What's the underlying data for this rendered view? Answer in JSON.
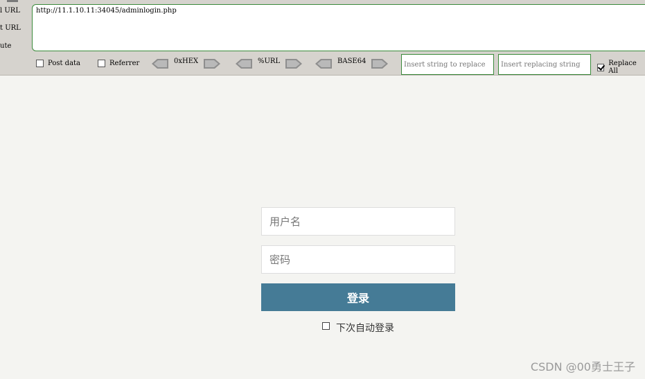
{
  "hackbar": {
    "side_labels": [
      "l URL",
      "t URL",
      "ute"
    ],
    "url_value": "http://11.1.10.11:34045/adminlogin.php",
    "post_data_label": "Post data",
    "referrer_label": "Referrer",
    "hex_label": "0xHEX",
    "url_enc_label": "%URL",
    "base64_label": "BASE64",
    "insert_string_placeholder": "Insert string to replace",
    "insert_replacing_placeholder": "Insert replacing string",
    "replace_all_label": "Replace All",
    "post_data_checked": false,
    "referrer_checked": false,
    "replace_all_checked": true,
    "border_color": "#3a8a3a"
  },
  "login": {
    "username_placeholder": "用户名",
    "password_placeholder": "密码",
    "submit_label": "登录",
    "remember_label": "下次自动登录",
    "remember_checked": false,
    "button_color": "#457b96"
  },
  "watermark": "CSDN @00勇士王子"
}
